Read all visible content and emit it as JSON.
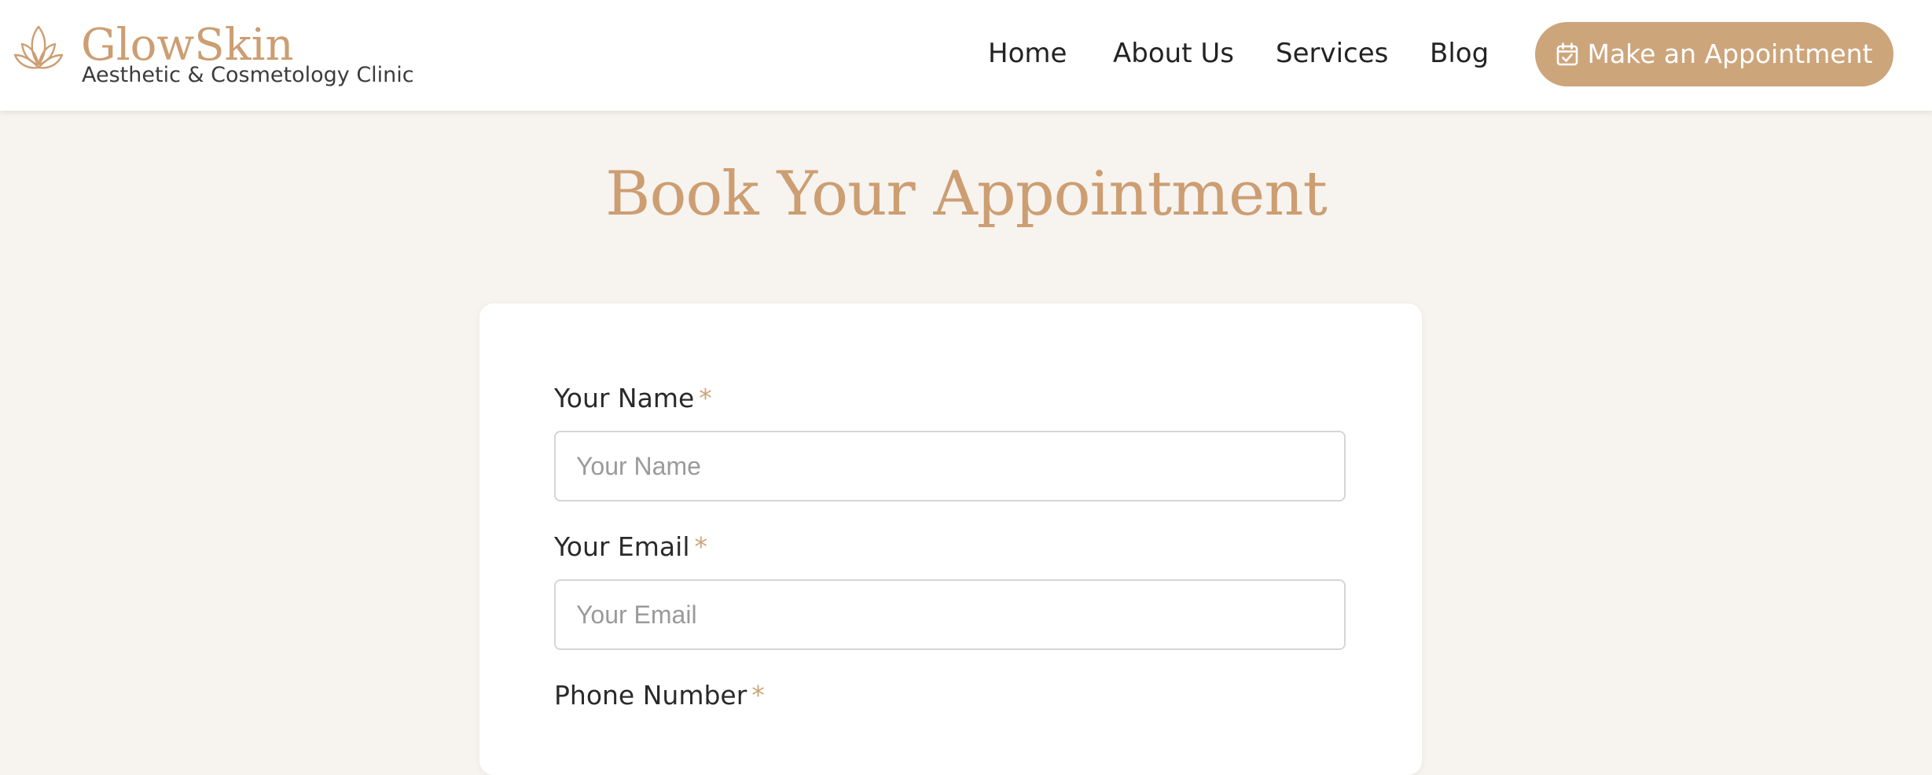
{
  "brand": {
    "name": "GlowSkin",
    "tagline": "Aesthetic & Cosmetology Clinic",
    "icon": "lotus-icon",
    "accent_color": "#cda57b"
  },
  "nav": {
    "items": [
      {
        "label": "Home"
      },
      {
        "label": "About Us"
      },
      {
        "label": "Services"
      },
      {
        "label": "Blog"
      }
    ],
    "cta": {
      "label": "Make an Appointment",
      "icon": "calendar-check-icon"
    }
  },
  "page": {
    "title": "Book Your Appointment"
  },
  "form": {
    "required_marker": "*",
    "fields": [
      {
        "label": "Your Name",
        "placeholder": "Your Name",
        "value": ""
      },
      {
        "label": "Your Email",
        "placeholder": "Your Email",
        "value": ""
      },
      {
        "label": "Phone Number"
      }
    ]
  }
}
